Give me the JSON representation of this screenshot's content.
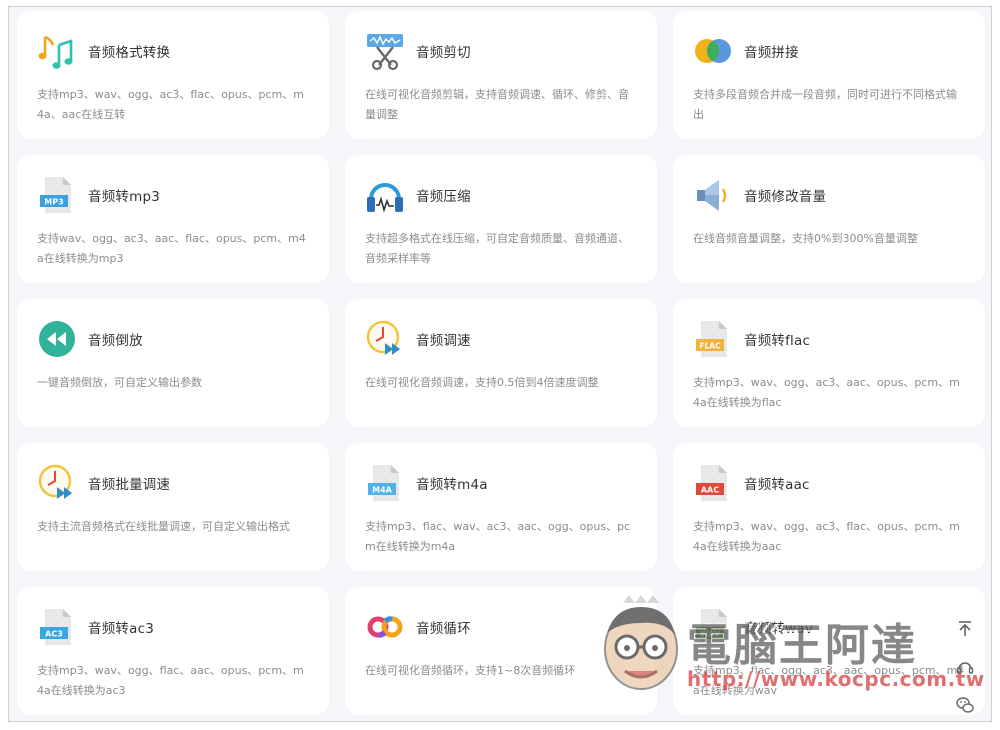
{
  "tools": [
    {
      "title": "音频格式转换",
      "desc": "支持mp3、wav、ogg、ac3、flac、opus、pcm、m4a、aac在线互转",
      "icon": "music-notes-icon"
    },
    {
      "title": "音频剪切",
      "desc": "在线可视化音频剪辑，支持音频调速、循环、修剪、音量调整",
      "icon": "scissors-icon"
    },
    {
      "title": "音频拼接",
      "desc": "支持多段音频合并成一段音频，同时可进行不同格式输出",
      "icon": "merge-circles-icon"
    },
    {
      "title": "音频转mp3",
      "desc": "支持wav、ogg、ac3、aac、flac、opus、pcm、m4a在线转换为mp3",
      "icon": "mp3-file-icon",
      "badge": "MP3"
    },
    {
      "title": "音频压缩",
      "desc": "支持超多格式在线压缩，可自定音频质量、音频通道、音频采样率等",
      "icon": "headphones-icon"
    },
    {
      "title": "音频修改音量",
      "desc": "在线音频音量调整，支持0%到300%音量调整",
      "icon": "speaker-icon"
    },
    {
      "title": "音频倒放",
      "desc": "一键音频倒放，可自定义输出参数",
      "icon": "rewind-icon"
    },
    {
      "title": "音频调速",
      "desc": "在线可视化音频调速，支持0.5倍到4倍速度调整",
      "icon": "speed-clock-icon"
    },
    {
      "title": "音频转flac",
      "desc": "支持mp3、wav、ogg、ac3、aac、opus、pcm、m4a在线转换为flac",
      "icon": "flac-file-icon",
      "badge": "FLAC"
    },
    {
      "title": "音频批量调速",
      "desc": "支持主流音频格式在线批量调速，可自定义输出格式",
      "icon": "batch-speed-clock-icon"
    },
    {
      "title": "音频转m4a",
      "desc": "支持mp3、flac、wav、ac3、aac、ogg、opus、pcm在线转换为m4a",
      "icon": "m4a-file-icon",
      "badge": "M4A"
    },
    {
      "title": "音频转aac",
      "desc": "支持mp3、wav、ogg、ac3、flac、opus、pcm、m4a在线转换为aac",
      "icon": "aac-file-icon",
      "badge": "AAC"
    },
    {
      "title": "音频转ac3",
      "desc": "支持mp3、wav、ogg、flac、aac、opus、pcm、m4a在线转换为ac3",
      "icon": "ac3-file-icon",
      "badge": "AC3"
    },
    {
      "title": "音频循环",
      "desc": "在线可视化音频循环，支持1~8次音频循环",
      "icon": "loop-icon"
    },
    {
      "title": "音频转wav",
      "desc": "支持mp3、flac、ogg、ac3、aac、opus、pcm、m4a在线转换为wav",
      "icon": "wav-file-icon",
      "badge": "WAV"
    }
  ],
  "colors": {
    "page_bg": "#f5f6fa",
    "card_bg": "#ffffff",
    "title": "#333333",
    "desc": "#8c8c8c",
    "mp3_badge": "#3aa0e0",
    "flac_badge": "#f2b23c",
    "m4a_badge": "#4fb3e8",
    "aac_badge": "#e04a3c",
    "ac3_badge": "#3aa8e0",
    "wav_badge": "#5c9a3c"
  },
  "side_tools": [
    {
      "name": "back-to-top-icon"
    },
    {
      "name": "headset-support-icon"
    },
    {
      "name": "wechat-icon"
    }
  ],
  "watermark": {
    "text": "電腦王阿達",
    "url": "http://www.kocpc.com.tw"
  }
}
